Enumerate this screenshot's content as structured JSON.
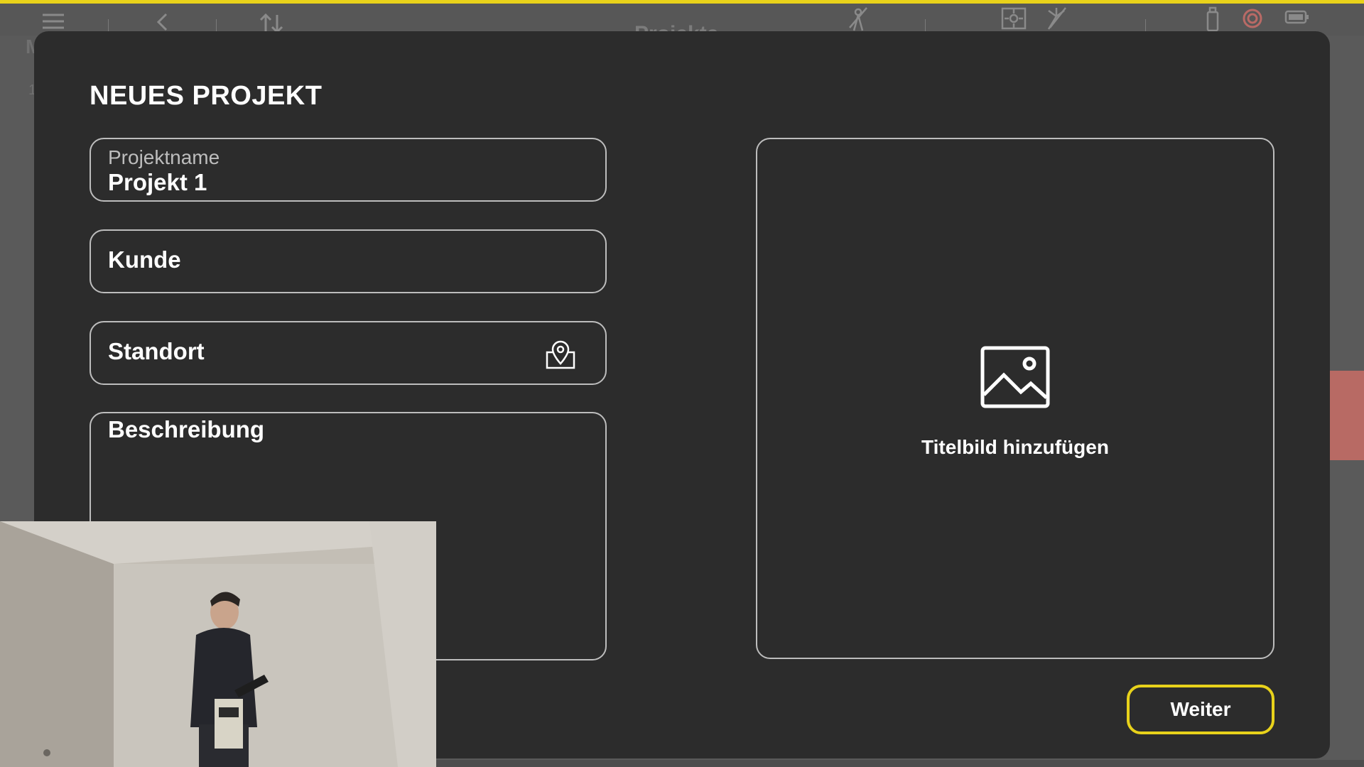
{
  "colors": {
    "accent": "#e8d21b",
    "dialog_bg": "#2c2c2c",
    "border": "#bdbdbd",
    "text": "#ffffff"
  },
  "app": {
    "title": "Projekte",
    "left_letter": "M",
    "left_number": "1",
    "toolbar_icons": [
      "menu-icon",
      "back-icon",
      "sort-icon",
      "no-signal-icon",
      "scan-frame-icon",
      "laser-off-icon",
      "device-icon",
      "record-icon",
      "battery-icon"
    ]
  },
  "dialog": {
    "title": "NEUES PROJEKT",
    "fields": {
      "project_name": {
        "label": "Projektname",
        "value": "Projekt 1"
      },
      "customer": {
        "placeholder": "Kunde"
      },
      "location": {
        "placeholder": "Standort",
        "icon": "location-pin-icon"
      },
      "description": {
        "placeholder": "Beschreibung"
      }
    },
    "image_upload": {
      "label": "Titelbild hinzufügen",
      "icon": "image-icon"
    },
    "next_button": "Weiter"
  },
  "webcam": {
    "description_icon": "webcam-overlay"
  }
}
